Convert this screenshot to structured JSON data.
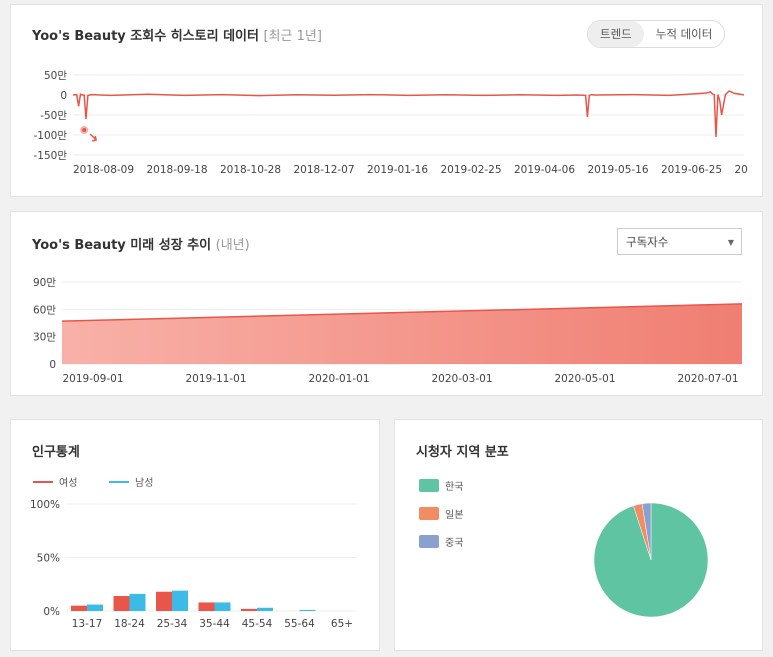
{
  "history": {
    "title": "Yoo's Beauty 조회수 히스토리 데이터",
    "subtitle": "[최근 1년]",
    "tabs": [
      "트렌드",
      "누적 데이터"
    ],
    "active_tab": 0
  },
  "growth": {
    "title": "Yoo's Beauty 미래 성장 추이",
    "subtitle": "(내년)",
    "select_value": "구독자수"
  },
  "demographics": {
    "title": "인구통계",
    "legend": [
      "여성",
      "남성"
    ]
  },
  "region": {
    "title": "시청자 지역 분포",
    "legend": [
      "한국",
      "일본",
      "중국"
    ]
  },
  "chart_data": [
    {
      "id": "history",
      "type": "line",
      "ylabels": [
        "50만",
        "0",
        "-50만",
        "-100만",
        "-150만"
      ],
      "ylim": [
        -1500000,
        500000
      ],
      "ylim_label": "만 단위 (10,000)",
      "xlabels": [
        "2018-08-09",
        "2018-09-18",
        "2018-10-28",
        "2018-12-07",
        "2019-01-16",
        "2019-02-25",
        "2019-04-06",
        "2019-05-16",
        "2019-06-25",
        "20"
      ],
      "color": "#e8564a",
      "series": [
        {
          "x": [
            0,
            2,
            3,
            4,
            5,
            6,
            7,
            8,
            10,
            20,
            40,
            60,
            80,
            100,
            120,
            140,
            160,
            180,
            200,
            220,
            240,
            260,
            270,
            275,
            276,
            277,
            278,
            280,
            300,
            320,
            330,
            340,
            342,
            343,
            344,
            345,
            346,
            347,
            348,
            350,
            352,
            355,
            358,
            360
          ],
          "y": [
            0,
            10000,
            -280000,
            20000,
            0,
            -5000,
            -600000,
            -10000,
            10000,
            -10000,
            20000,
            -10000,
            10000,
            -15000,
            5000,
            -5000,
            10000,
            -10000,
            5000,
            -10000,
            5000,
            -10000,
            0,
            -10000,
            -550000,
            -10000,
            10000,
            0,
            10000,
            -10000,
            20000,
            50000,
            80000,
            30000,
            10000,
            -1050000,
            10000,
            -150000,
            -500000,
            10000,
            100000,
            40000,
            20000,
            0
          ]
        }
      ],
      "annotation": {
        "x": 6,
        "label": "marker"
      }
    },
    {
      "id": "growth",
      "type": "area",
      "ylabels": [
        "90만",
        "60만",
        "30만",
        "0"
      ],
      "ylim": [
        0,
        900000
      ],
      "xlabels": [
        "2019-09-01",
        "2019-11-01",
        "2020-01-01",
        "2020-03-01",
        "2020-05-01",
        "2020-07-01"
      ],
      "series": [
        {
          "name": "구독자수",
          "start": 470000,
          "end": 660000
        }
      ]
    },
    {
      "id": "demographics",
      "type": "bar",
      "categories": [
        "13-17",
        "18-24",
        "25-34",
        "35-44",
        "45-54",
        "55-64",
        "65+"
      ],
      "ylabels": [
        "100%",
        "50%",
        "0%"
      ],
      "ylim": [
        0,
        100
      ],
      "series": [
        {
          "name": "여성",
          "color": "#e8564a",
          "values": [
            5,
            14,
            18,
            8,
            2,
            0,
            0
          ]
        },
        {
          "name": "남성",
          "color": "#3bbbe6",
          "values": [
            6,
            16,
            19,
            8,
            3,
            1,
            0
          ]
        }
      ]
    },
    {
      "id": "region",
      "type": "pie",
      "series": [
        {
          "name": "한국",
          "value": 95,
          "color": "#5ec4a2"
        },
        {
          "name": "일본",
          "value": 2.5,
          "color": "#f28c63"
        },
        {
          "name": "중국",
          "value": 2.5,
          "color": "#8aa0ce"
        }
      ]
    }
  ]
}
